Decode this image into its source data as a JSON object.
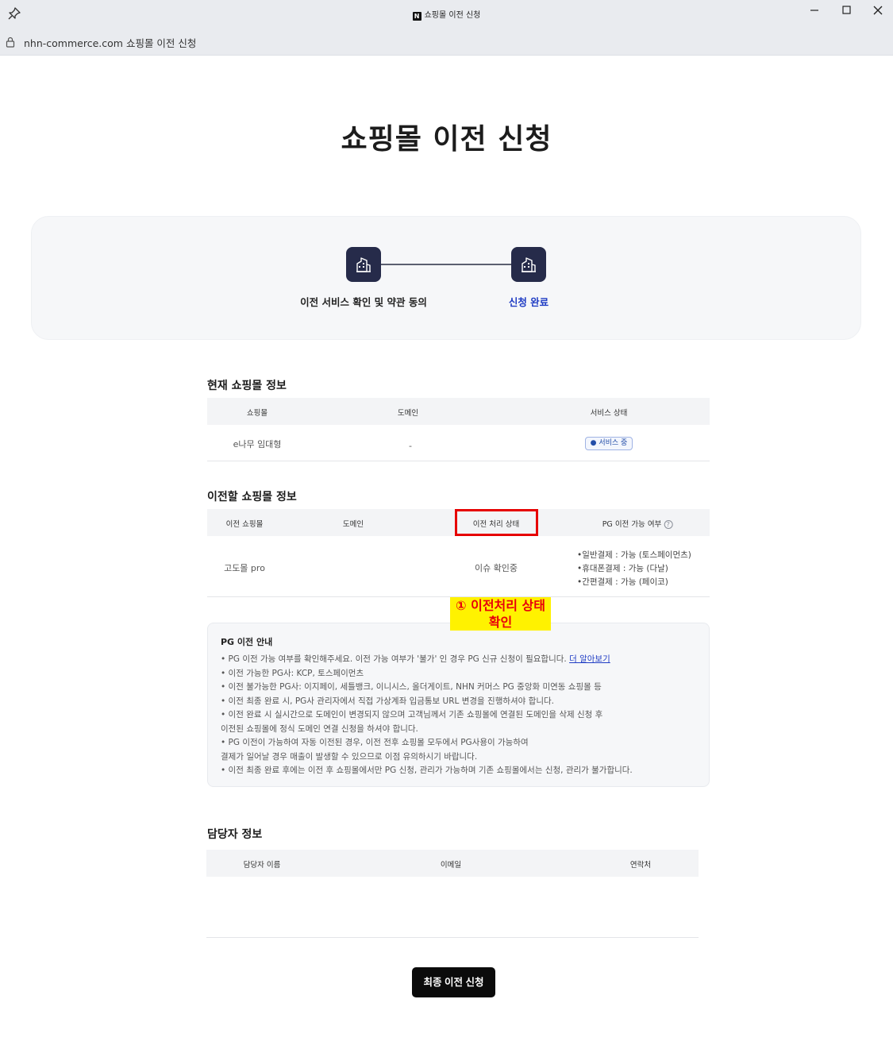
{
  "window": {
    "title": "쇼핑몰 이전 신청",
    "logo_letter": "N",
    "url_domain": "nhn-commerce.com",
    "url_title": "쇼핑몰 이전 신청"
  },
  "page_title": "쇼핑몰 이전 신청",
  "steps": [
    {
      "label": "이전 서비스 확인 및 약관 동의"
    },
    {
      "label": "신청 완료"
    }
  ],
  "current_mall": {
    "title": "현재 쇼핑몰 정보",
    "headers": [
      "쇼핑몰",
      "도메인",
      "서비스 상태"
    ],
    "row": {
      "mall": "e나무 임대형",
      "domain": "-",
      "status": "● 서비스 중"
    }
  },
  "target_mall": {
    "title": "이전할 쇼핑몰 정보",
    "headers": [
      "이전 쇼핑몰",
      "도메인",
      "이전 처리 상태",
      "PG 이전 가능 여부"
    ],
    "help_icon": "?",
    "row": {
      "mall": "고도몰 pro",
      "domain": "",
      "process_status": "이슈 확인중",
      "pg": [
        "•일반결제 : 가능 (토스페이먼츠)",
        "•휴대폰결제 : 가능 (다날)",
        "•간편결제 : 가능 (페이코)"
      ]
    }
  },
  "annotation": {
    "line1": "① 이전처리 상태",
    "line2": "확인"
  },
  "pg_guide": {
    "title": "PG 이전 안내",
    "line1": "• PG 이전 가능 여부를 확인해주세요. 이전 가능 여부가 '불가' 인 경우 PG 신규 신청이 필요합니다.",
    "learn_more": "더 알아보기",
    "lines": [
      "  • 이전 가능한 PG사: KCP, 토스페이먼츠",
      "  • 이전 불가능한 PG사: 이지페이, 세틀뱅크, 이니시스, 올더게이트, NHN 커머스 PG 중앙화 미연동 쇼핑몰 등",
      "• 이전 최종 완료 시, PG사 관리자에서 직접 가상계좌 입금통보 URL 변경을 진행하셔야 합니다.",
      "• 이전 완료 시 실시간으로 도메인이 변경되지 않으며 고객님께서 기존 쇼핑몰에 연결된 도메인을 삭제 신청 후",
      "   이전된 쇼핑몰에 정식 도메인 연결 신청을 하셔야 합니다.",
      "• PG 이전이 가능하여 자동 이전된 경우, 이전 전후 쇼핑몰 모두에서 PG사용이 가능하여",
      "   결제가 일어날 경우 매출이 발생할 수 있으므로 이점 유의하시기 바랍니다.",
      "• 이전 최종 완료 후에는 이전 후 쇼핑몰에서만 PG 신청, 관리가 가능하며 기존 쇼핑몰에서는 신청, 관리가 불가합니다."
    ]
  },
  "manager": {
    "title": "담당자 정보",
    "headers": [
      "담당자 이름",
      "이메일",
      "연락처"
    ]
  },
  "submit_label": "최종 이전 신청",
  "colors": {
    "step_icon": "#262b4a",
    "active_step": "#1f3cc4",
    "highlight": "#e60000",
    "annotation_bg": "#fff200"
  }
}
